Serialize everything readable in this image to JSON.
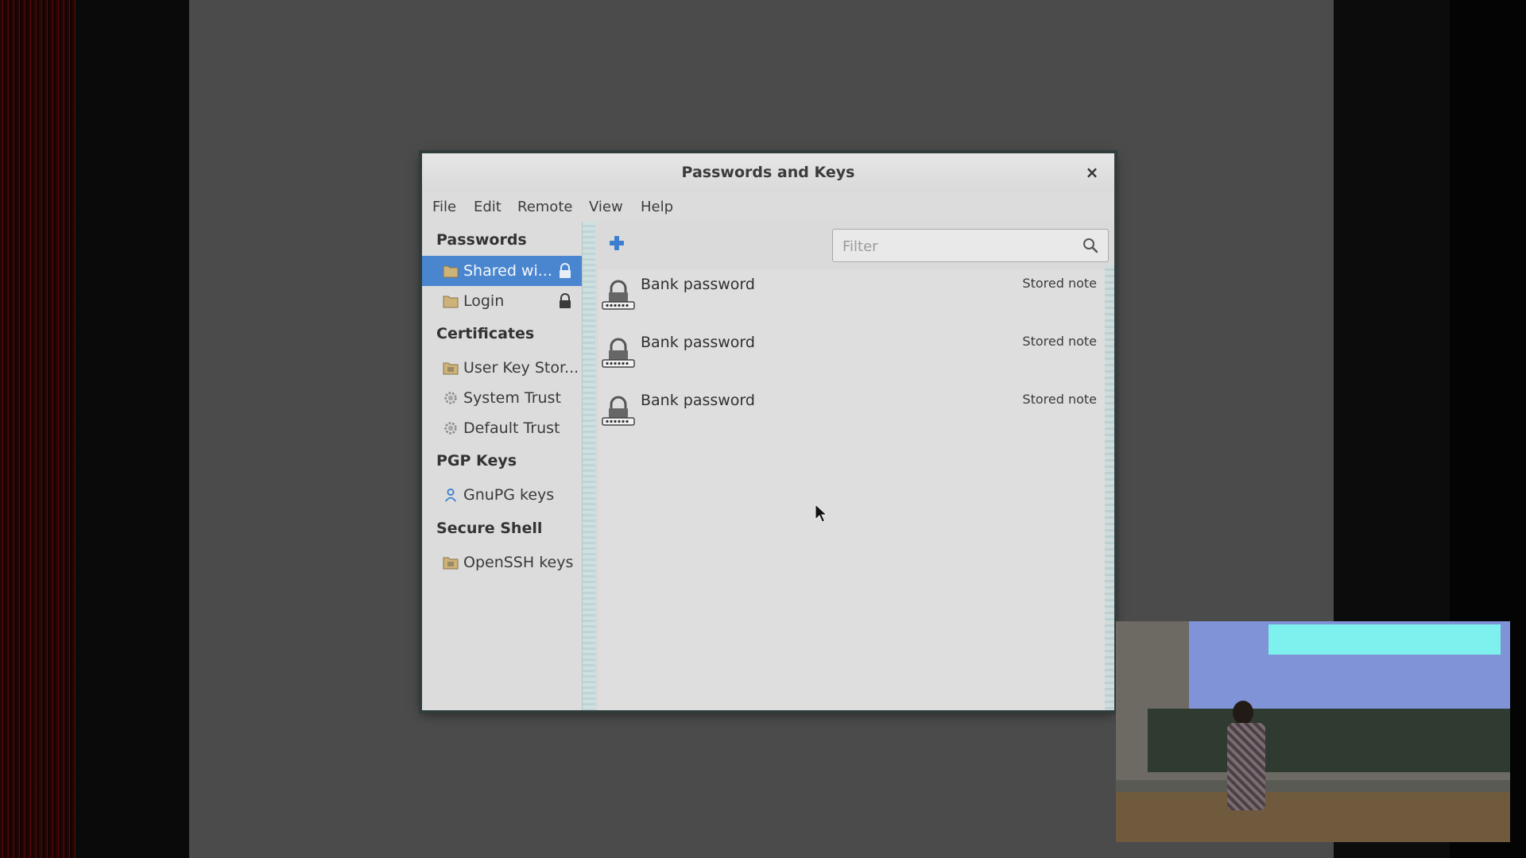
{
  "window": {
    "title": "Passwords and Keys",
    "close_glyph": "×"
  },
  "menu": [
    {
      "label": "File"
    },
    {
      "label": "Edit"
    },
    {
      "label": "Remote"
    },
    {
      "label": "View"
    },
    {
      "label": "Help"
    }
  ],
  "sidebar": {
    "sections": [
      {
        "header": "Passwords",
        "items": [
          {
            "label": "Shared wi...",
            "icon": "folder-icon",
            "locked": true,
            "selected": true
          },
          {
            "label": "Login",
            "icon": "folder-icon",
            "locked": true,
            "selected": false
          }
        ]
      },
      {
        "header": "Certificates",
        "items": [
          {
            "label": "User Key Stor...",
            "icon": "folder-icon"
          },
          {
            "label": "System Trust",
            "icon": "gear-icon"
          },
          {
            "label": "Default Trust",
            "icon": "gear-icon"
          }
        ]
      },
      {
        "header": "PGP Keys",
        "items": [
          {
            "label": "GnuPG keys",
            "icon": "person-icon"
          }
        ]
      },
      {
        "header": "Secure Shell",
        "items": [
          {
            "label": "OpenSSH keys",
            "icon": "folder-icon"
          }
        ]
      }
    ]
  },
  "toolbar": {
    "add_icon": "plus-icon",
    "filter_placeholder": "Filter",
    "search_icon": "search-icon"
  },
  "list": {
    "items": [
      {
        "name": "Bank password",
        "type": "Stored note",
        "icon": "password-lock-icon"
      },
      {
        "name": "Bank password",
        "type": "Stored note",
        "icon": "password-lock-icon"
      },
      {
        "name": "Bank password",
        "type": "Stored note",
        "icon": "password-lock-icon"
      }
    ]
  },
  "colors": {
    "selection": "#4a86cf",
    "add_icon": "#3d7fcf"
  }
}
